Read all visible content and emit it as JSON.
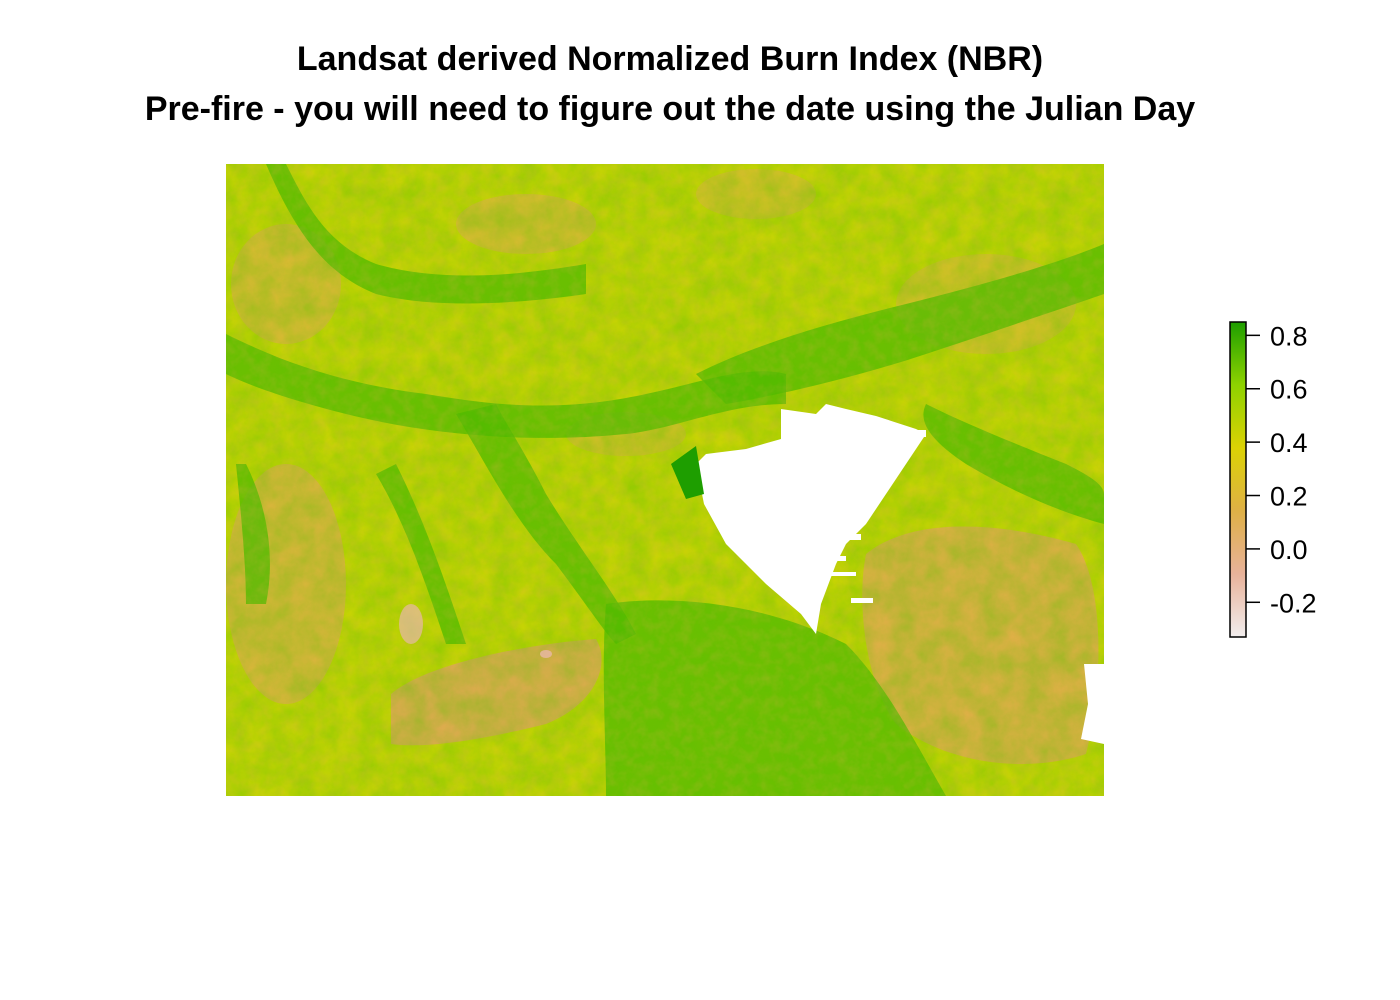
{
  "chart_data": {
    "type": "heatmap",
    "title": "Landsat derived Normalized Burn Index (NBR)",
    "subtitle": "Pre-fire - you will need to figure out the date using the Julian Day",
    "colorbar": {
      "min": -0.33,
      "max": 0.85,
      "ticks": [
        "0.8",
        "0.6",
        "0.4",
        "0.2",
        "0.0",
        "-0.2"
      ],
      "tick_values": [
        0.8,
        0.6,
        0.4,
        0.2,
        0.0,
        -0.2
      ],
      "colors": [
        "#f2eeee",
        "#e8b29a",
        "#deb046",
        "#dcd204",
        "#8ed200",
        "#1e9e00"
      ],
      "placement": "right"
    },
    "grid": false,
    "nodata_color": "#ffffff"
  }
}
